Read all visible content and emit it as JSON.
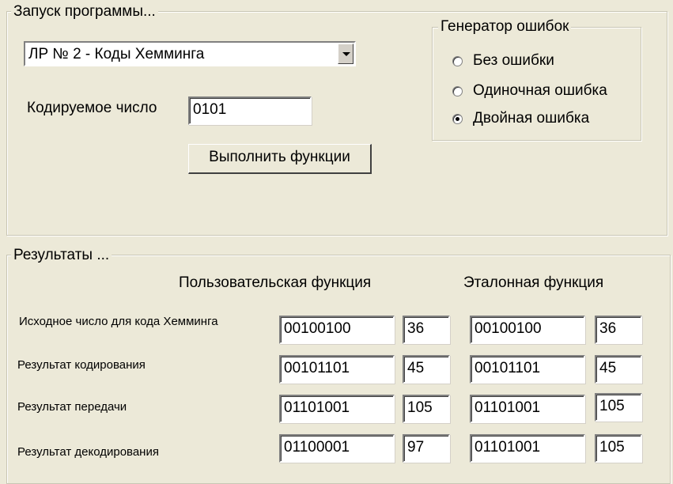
{
  "launch_group": {
    "title": "Запуск программы...",
    "lab_select": "ЛР № 2 - Коды Хемминга",
    "input_label": "Кодируемое число",
    "input_value": "0101",
    "run_button": "Выполнить функции"
  },
  "error_generator": {
    "title": "Генератор ошибок",
    "options": [
      {
        "label": "Без ошибки",
        "checked": false
      },
      {
        "label": "Одиночная ошибка",
        "checked": false
      },
      {
        "label": "Двойная ошибка",
        "checked": true
      }
    ]
  },
  "results": {
    "title": "Результаты ...",
    "user_header": "Пользовательская функция",
    "reference_header": "Эталонная функция",
    "rows": [
      {
        "label": "Исходное число для кода Хемминга",
        "user_bin": "00100100",
        "user_dec": "36",
        "ref_bin": "00100100",
        "ref_dec": "36"
      },
      {
        "label": "Результат кодирования",
        "user_bin": "00101101",
        "user_dec": "45",
        "ref_bin": "00101101",
        "ref_dec": "45"
      },
      {
        "label": "Результат передачи",
        "user_bin": "01101001",
        "user_dec": "105",
        "ref_bin": "01101001",
        "ref_dec": "105"
      },
      {
        "label": "Результат декодирования",
        "user_bin": "01100001",
        "user_dec": "97",
        "ref_bin": "01101001",
        "ref_dec": "105"
      }
    ]
  }
}
